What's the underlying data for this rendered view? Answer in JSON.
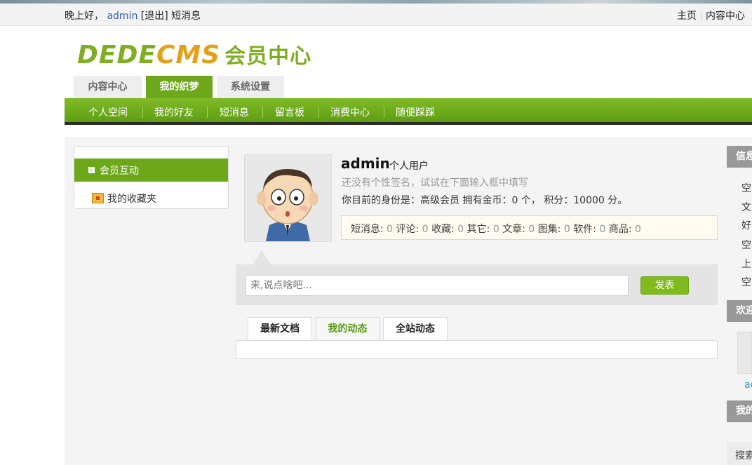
{
  "topbar": {
    "greeting": "晚上好，",
    "username": "admin",
    "logout": "[退出]",
    "messages": "短消息",
    "home": "主页",
    "content_center": "内容中心"
  },
  "logo": {
    "brand_a": "DEDE",
    "brand_b": "CMS",
    "subtitle": "会员中心"
  },
  "main_tabs": [
    "内容中心",
    "我的织梦",
    "系统设置"
  ],
  "main_tab_active": 1,
  "nav": [
    "个人空间",
    "我的好友",
    "短消息",
    "留言板",
    "消费中心",
    "随便踩踩"
  ],
  "sidebar": {
    "section": "会员互动",
    "item": "我的收藏夹"
  },
  "profile": {
    "name": "admin",
    "type": "个人用户",
    "signature": "还没有个性签名，试试在下面输入框中填写",
    "status": "你目前的身份是：高级会员 拥有金币：0 个， 积分：10000 分。"
  },
  "stats": [
    {
      "label": "短消息:",
      "value": "0"
    },
    {
      "label": "评论:",
      "value": "0"
    },
    {
      "label": "收藏:",
      "value": "0"
    },
    {
      "label": "其它:",
      "value": "0"
    },
    {
      "label": "文章:",
      "value": "0"
    },
    {
      "label": "图集:",
      "value": "0"
    },
    {
      "label": "软件:",
      "value": "0"
    },
    {
      "label": "商品:",
      "value": "0"
    }
  ],
  "post": {
    "placeholder": "来,说点啥吧...",
    "button": "发表"
  },
  "feed_tabs": [
    "最新文档",
    "我的动态",
    "全站动态"
  ],
  "feed_tab_active": 1,
  "right": {
    "header1": "信息",
    "lines": [
      "空",
      "文",
      "好",
      "空",
      "上",
      "空"
    ],
    "header2": "欢迎",
    "user_link": "ad",
    "header3": "我的",
    "search": "搜索"
  },
  "colors": {
    "accent_green": "#6da81a",
    "nav_green": "#7fbb26",
    "link_blue": "#3160b6"
  }
}
